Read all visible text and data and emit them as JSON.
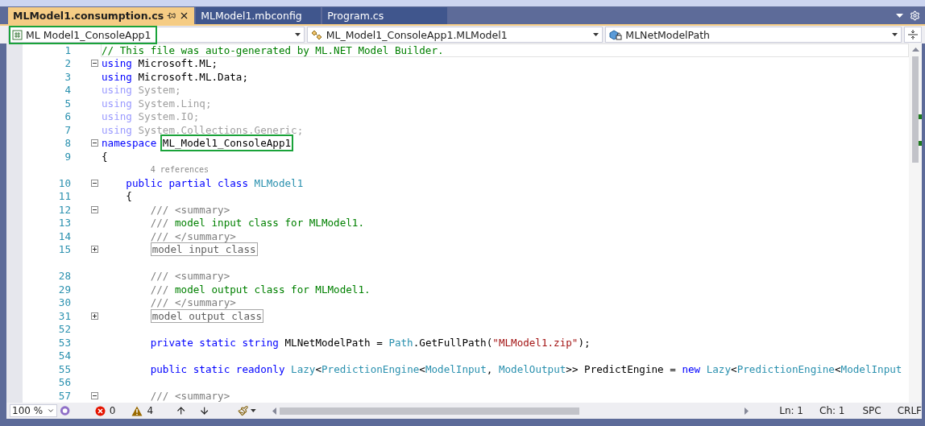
{
  "tabs": [
    {
      "label": "MLModel1.consumption.cs",
      "selected": true
    },
    {
      "label": "MLModel1.mbconfig",
      "selected": false
    },
    {
      "label": "Program.cs",
      "selected": false
    }
  ],
  "nav_bar": {
    "dropdowns": [
      {
        "kind": "project",
        "value": "ML Model1_ConsoleApp1",
        "highlighted": true
      },
      {
        "kind": "class",
        "value": "ML_Model1_ConsoleApp1.MLModel1",
        "highlighted": false
      },
      {
        "kind": "field",
        "value": "MLNetModelPath",
        "highlighted": false
      }
    ]
  },
  "editor": {
    "lines": [
      {
        "kind": "code",
        "number": "1",
        "current": true,
        "tokens": [
          {
            "kind": "comment",
            "text": "// This file was auto-generated by ML.NET Model Builder."
          }
        ]
      },
      {
        "kind": "code",
        "number": "2",
        "current": false,
        "collapsed": false,
        "tokens": [
          {
            "kind": "keyword",
            "text": "using"
          },
          {
            "kind": "plain",
            "text": " Microsoft.ML;"
          }
        ]
      },
      {
        "kind": "code",
        "number": "3",
        "current": false,
        "tokens": [
          {
            "kind": "keyword",
            "text": "using"
          },
          {
            "kind": "plain",
            "text": " Microsoft.ML.Data;"
          }
        ]
      },
      {
        "kind": "code",
        "number": "4",
        "current": false,
        "tokens": [
          {
            "kind": "unused-keyword",
            "text": "using"
          },
          {
            "kind": "unused",
            "text": " System;"
          }
        ]
      },
      {
        "kind": "code",
        "number": "5",
        "current": false,
        "tokens": [
          {
            "kind": "unused-keyword",
            "text": "using"
          },
          {
            "kind": "unused",
            "text": " System.Linq;"
          }
        ]
      },
      {
        "kind": "code",
        "number": "6",
        "current": false,
        "tokens": [
          {
            "kind": "unused-keyword",
            "text": "using"
          },
          {
            "kind": "unused",
            "text": " System.IO;"
          }
        ]
      },
      {
        "kind": "code",
        "number": "7",
        "current": false,
        "tokens": [
          {
            "kind": "unused-keyword",
            "text": "using"
          },
          {
            "kind": "unused",
            "text": " System.Collections.Generic;"
          }
        ]
      },
      {
        "kind": "code",
        "number": "8",
        "current": false,
        "collapsed": false,
        "tokens": [
          {
            "kind": "keyword",
            "text": "namespace"
          },
          {
            "kind": "plain",
            "text": " ML_Model1_ConsoleApp1",
            "highlighted": true
          }
        ]
      },
      {
        "kind": "code",
        "number": "9",
        "current": false,
        "tokens": [
          {
            "kind": "plain",
            "text": "{"
          }
        ]
      },
      {
        "kind": "codelens",
        "text": "        4 references"
      },
      {
        "kind": "code",
        "number": "10",
        "current": false,
        "collapsed": false,
        "tokens": [
          {
            "kind": "keyword",
            "text": "    public partial class"
          },
          {
            "kind": "type",
            "text": " MLModel1"
          }
        ]
      },
      {
        "kind": "code",
        "number": "11",
        "current": false,
        "tokens": [
          {
            "kind": "plain",
            "text": "    {"
          }
        ]
      },
      {
        "kind": "code",
        "number": "12",
        "current": false,
        "collapsed": false,
        "tokens": [
          {
            "kind": "doc",
            "text": "        /// <summary>"
          }
        ]
      },
      {
        "kind": "code",
        "number": "13",
        "current": false,
        "tokens": [
          {
            "kind": "doc",
            "text": "        ///"
          },
          {
            "kind": "comment",
            "text": " model input class for MLModel1."
          }
        ]
      },
      {
        "kind": "code",
        "number": "14",
        "current": false,
        "tokens": [
          {
            "kind": "doc",
            "text": "        /// </summary>"
          }
        ]
      },
      {
        "kind": "code",
        "number": "15",
        "current": false,
        "collapsed": true,
        "tokens": [
          {
            "kind": "collapsed",
            "text": "        model input class"
          }
        ]
      },
      {
        "kind": "gap"
      },
      {
        "kind": "code",
        "number": "28",
        "current": false,
        "tokens": [
          {
            "kind": "doc",
            "text": "        /// <summary>"
          }
        ]
      },
      {
        "kind": "code",
        "number": "29",
        "current": false,
        "tokens": [
          {
            "kind": "doc",
            "text": "        ///"
          },
          {
            "kind": "comment",
            "text": " model output class for MLModel1."
          }
        ]
      },
      {
        "kind": "code",
        "number": "30",
        "current": false,
        "tokens": [
          {
            "kind": "doc",
            "text": "        /// </summary>"
          }
        ]
      },
      {
        "kind": "code",
        "number": "31",
        "current": false,
        "collapsed": true,
        "tokens": [
          {
            "kind": "collapsed",
            "text": "        model output class"
          }
        ]
      },
      {
        "kind": "code",
        "number": "52",
        "current": false
      },
      {
        "kind": "code",
        "number": "53",
        "current": false,
        "tokens": [
          {
            "kind": "keyword",
            "text": "        private static string"
          },
          {
            "kind": "plain",
            "text": " MLNetModelPath = "
          },
          {
            "kind": "type",
            "text": "Path"
          },
          {
            "kind": "plain",
            "text": ".GetFullPath("
          },
          {
            "kind": "string",
            "text": "\"MLModel1.zip\""
          },
          {
            "kind": "plain",
            "text": ");"
          }
        ]
      },
      {
        "kind": "code",
        "number": "54",
        "current": false
      },
      {
        "kind": "code",
        "number": "55",
        "current": false,
        "tokens": [
          {
            "kind": "keyword",
            "text": "        public static readonly"
          },
          {
            "kind": "type",
            "text": " Lazy"
          },
          {
            "kind": "plain",
            "text": "<"
          },
          {
            "kind": "type",
            "text": "PredictionEngine"
          },
          {
            "kind": "plain",
            "text": "<"
          },
          {
            "kind": "type",
            "text": "ModelInput"
          },
          {
            "kind": "plain",
            "text": ", "
          },
          {
            "kind": "type",
            "text": "ModelOutput"
          },
          {
            "kind": "plain",
            "text": ">> PredictEngine = "
          },
          {
            "kind": "keyword",
            "text": "new"
          },
          {
            "kind": "type",
            "text": " Lazy"
          },
          {
            "kind": "plain",
            "text": "<"
          },
          {
            "kind": "type",
            "text": "PredictionEngine"
          },
          {
            "kind": "plain",
            "text": "<"
          },
          {
            "kind": "type",
            "text": "ModelInput"
          }
        ]
      },
      {
        "kind": "code",
        "number": "56",
        "current": false
      },
      {
        "kind": "code",
        "number": "57",
        "current": false,
        "collapsed": false,
        "tokens": [
          {
            "kind": "doc",
            "text": "        /// <summary>"
          }
        ]
      }
    ]
  },
  "status_bar": {
    "zoom": "100 %",
    "errors": "0",
    "warnings": "4",
    "line": "Ln: 1",
    "column": "Ch: 1",
    "indent": "SPC",
    "line_ending": "CRLF"
  }
}
